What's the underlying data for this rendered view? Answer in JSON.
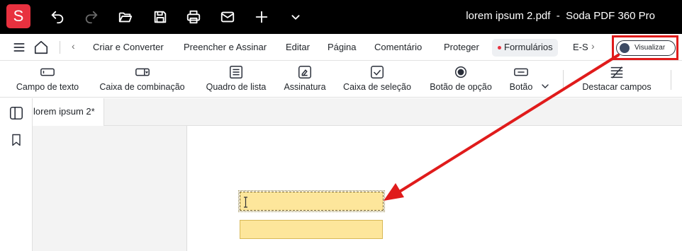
{
  "app": {
    "logo_letter": "S",
    "window_title": "lorem ipsum 2.pdf  -  Soda PDF 360 Pro"
  },
  "titlebar_icons": [
    "undo-icon",
    "redo-icon",
    "folder-open-icon",
    "save-icon",
    "print-icon",
    "mail-icon",
    "plus-icon",
    "chevron-down-icon"
  ],
  "menu": {
    "tabs": [
      "Criar e Converter",
      "Preencher e Assinar",
      "Editar",
      "Página",
      "Comentário",
      "Proteger",
      "Formulários",
      "E-S"
    ],
    "active_tab": "Formulários",
    "preview_label": "Visualizar"
  },
  "ribbon": {
    "items": [
      "Campo de texto",
      "Caixa de combinação",
      "Quadro de lista",
      "Assinatura",
      "Caixa de seleção",
      "Botão de opção",
      "Botão",
      "Destacar campos"
    ]
  },
  "document": {
    "tab_name": "lorem ipsum 2*"
  },
  "colors": {
    "titlebar": "#000000",
    "brand": "#e8313f",
    "field_fill": "#fde69b",
    "annotation": "#e01b1b"
  }
}
